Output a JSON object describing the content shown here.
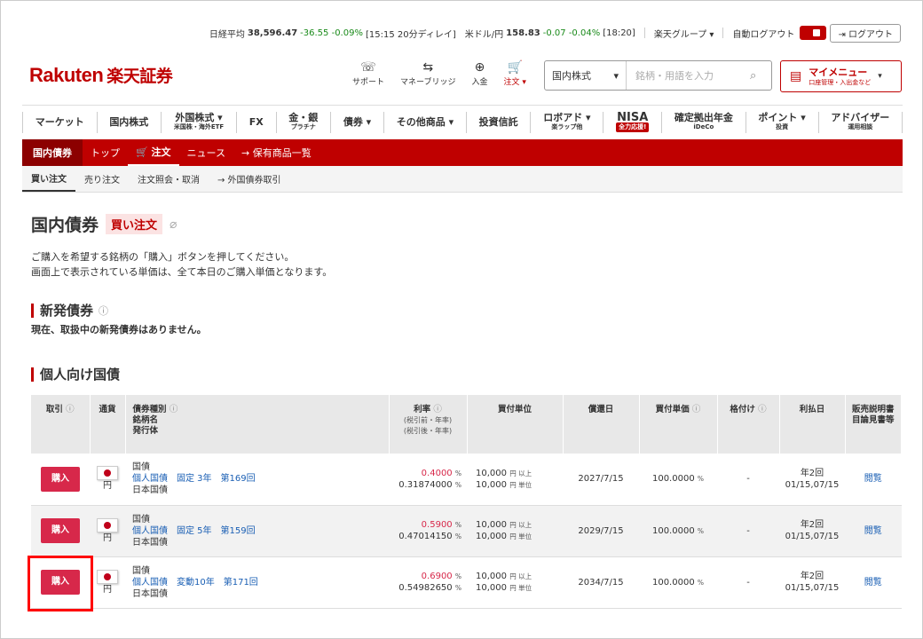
{
  "ticker": {
    "nikkei_label": "日経平均",
    "nikkei_value": "38,596.47",
    "nikkei_change": "-36.55 -0.09%",
    "nikkei_time": "[15:15 20分ディレイ]",
    "usd_label": "米ドル/円",
    "usd_value": "158.83",
    "usd_change": "-0.07 -0.04%",
    "usd_time": "[18:20]",
    "group": "楽天グループ ▾",
    "autologout": "自動ログアウト",
    "logout": "⇥ ログアウト"
  },
  "header": {
    "logo": "Rakuten",
    "logo_jp": "楽天証券",
    "icons": [
      {
        "glyph": "☏",
        "label": "サポート",
        "name": "support-icon"
      },
      {
        "glyph": "⇆",
        "label": "マネーブリッジ",
        "name": "money-bridge-icon"
      },
      {
        "glyph": "⊕",
        "label": "入金",
        "name": "deposit-icon"
      },
      {
        "glyph": "🛒",
        "label": "注文 ▾",
        "name": "cart-icon"
      }
    ],
    "search_select": "国内株式",
    "search_placeholder": "銘柄・用語を入力",
    "mymenu_title": "マイメニュー",
    "mymenu_sub": "口座管理・入出金など"
  },
  "gnav": [
    {
      "t": "マーケット",
      "s": ""
    },
    {
      "t": "国内株式",
      "s": ""
    },
    {
      "t": "外国株式 ▾",
      "s": "米国株・海外ETF"
    },
    {
      "t": "FX",
      "s": ""
    },
    {
      "t": "金・銀",
      "s": "プラチナ"
    },
    {
      "t": "債券 ▾",
      "s": ""
    },
    {
      "t": "その他商品 ▾",
      "s": ""
    },
    {
      "t": "投資信託",
      "s": ""
    },
    {
      "t": "ロボアド ▾",
      "s": "楽ラップ他"
    },
    {
      "t": "NISA",
      "s": "全力応援!"
    },
    {
      "t": "確定拠出年金",
      "s": "iDeCo"
    },
    {
      "t": "ポイント ▾",
      "s": "投資"
    },
    {
      "t": "アドバイザー",
      "s": "運用相談"
    }
  ],
  "rednav": {
    "lead": "国内債券",
    "items": [
      "トップ",
      "🛒 注文",
      "ニュース",
      "→ 保有商品一覧"
    ]
  },
  "subnav": [
    "買い注文",
    "売り注文",
    "注文照会・取消",
    "→ 外国債券取引"
  ],
  "page": {
    "title": "国内債券",
    "badge": "買い注文",
    "desc1": "ご購入を希望する銘柄の「購入」ボタンを押してください。",
    "desc2": "画面上で表示されている単価は、全て本日のご購入単価となります。",
    "sec1": "新発債券",
    "sec1_note": "現在、取扱中の新発債券はありません。",
    "sec2": "個人向け国債"
  },
  "table": {
    "headers": [
      "取引",
      "通貨",
      "債券種別",
      "銘柄名",
      "発行体",
      "利率",
      "(税引前・年率)",
      "(税引後・年率)",
      "買付単位",
      "償還日",
      "買付単価",
      "格付け",
      "利払日",
      "販売説明書",
      "目論見書等"
    ],
    "rows": [
      {
        "buy": "購入",
        "ccy": "円",
        "type": "国債",
        "name": "個人国債　固定 3年　第169回",
        "issuer": "日本国債",
        "rate_pre": "0.4000",
        "rate_post": "0.31874000",
        "unit1": "10,000",
        "unit1s": "円 以上",
        "unit2": "10,000",
        "unit2s": "円 単位",
        "maturity": "2027/7/15",
        "price": "100.0000",
        "rating": "-",
        "pay1": "年2回",
        "pay2": "01/15,07/15",
        "doc": "閲覧"
      },
      {
        "buy": "購入",
        "ccy": "円",
        "type": "国債",
        "name": "個人国債　固定 5年　第159回",
        "issuer": "日本国債",
        "rate_pre": "0.5900",
        "rate_post": "0.47014150",
        "unit1": "10,000",
        "unit1s": "円 以上",
        "unit2": "10,000",
        "unit2s": "円 単位",
        "maturity": "2029/7/15",
        "price": "100.0000",
        "rating": "-",
        "pay1": "年2回",
        "pay2": "01/15,07/15",
        "doc": "閲覧"
      },
      {
        "buy": "購入",
        "ccy": "円",
        "type": "国債",
        "name": "個人国債　変動10年　第171回",
        "issuer": "日本国債",
        "rate_pre": "0.6900",
        "rate_post": "0.54982650",
        "unit1": "10,000",
        "unit1s": "円 以上",
        "unit2": "10,000",
        "unit2s": "円 単位",
        "maturity": "2034/7/15",
        "price": "100.0000",
        "rating": "-",
        "pay1": "年2回",
        "pay2": "01/15,07/15",
        "doc": "閲覧"
      }
    ]
  },
  "colors": {
    "brand": "#bf0000",
    "buy": "#d7284a",
    "link": "#1a5fb4"
  }
}
